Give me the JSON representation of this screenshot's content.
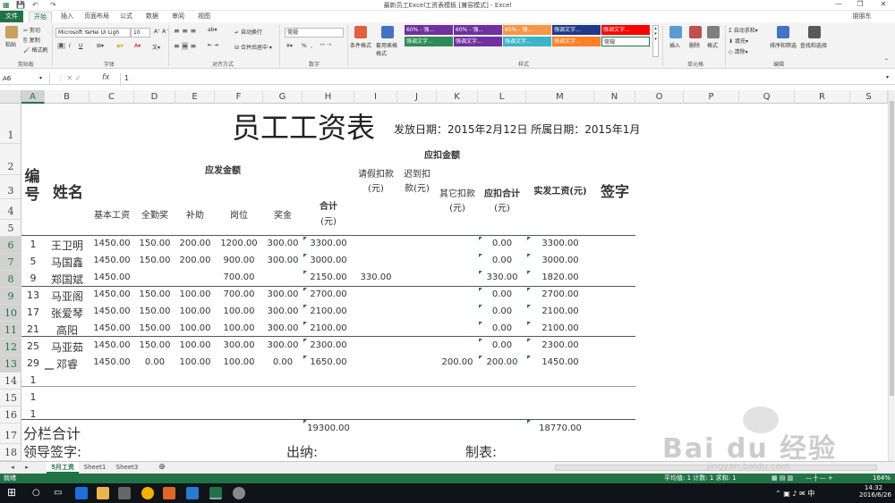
{
  "window": {
    "title": "最新员工Excel工资表模板 [兼容模式] - Excel",
    "user": "朋朋东"
  },
  "tabs": [
    "文件",
    "开始",
    "插入",
    "页面布局",
    "公式",
    "数据",
    "审阅",
    "视图"
  ],
  "ribbon": {
    "clipboard": {
      "paste": "粘贴",
      "cut": "剪切",
      "copy": "复制",
      "format_painter": "格式刷",
      "label": "剪贴板"
    },
    "font": {
      "name": "Microsoft YaHei UI Ligh",
      "size": "10",
      "label": "字体",
      "bold": "B",
      "italic": "I",
      "underline": "U"
    },
    "alignment": {
      "wrap": "自动换行",
      "merge": "合并后居中",
      "label": "对齐方式"
    },
    "number": {
      "format": "常规",
      "label": "数字",
      "percent": "%",
      "comma": ","
    },
    "styles": {
      "conditional": "条件格式",
      "table": "套用表格格式",
      "label": "样式",
      "cells": [
        {
          "text": "60% - 强...",
          "color": "#7030a0"
        },
        {
          "text": "60% - 强...",
          "color": "#7030a0"
        },
        {
          "text": "60% - 强...",
          "color": "#f79646"
        },
        {
          "text": "强调文字...",
          "color": "#1f3a8a"
        },
        {
          "text": "强调文字...",
          "color": "#ff0000"
        },
        {
          "text": "强调文字...",
          "color": "#2e8b57"
        },
        {
          "text": "强调文字...",
          "color": "#7030a0"
        },
        {
          "text": "强调文字...",
          "color": "#3cb4c8"
        },
        {
          "text": "强调文字...",
          "color": "#ff7f27"
        },
        {
          "text": "常规",
          "color": "#ffffff"
        }
      ]
    },
    "cells_grp": {
      "insert": "插入",
      "delete": "删除",
      "format": "格式",
      "label": "单元格"
    },
    "editing": {
      "autosum": "自动求和",
      "fill": "填充",
      "clear": "清除",
      "sort": "排序和筛选",
      "find": "查找和选择",
      "label": "编辑"
    }
  },
  "formula_bar": {
    "name_box": "A6",
    "fx": "fx",
    "value": "1"
  },
  "columns": [
    "A",
    "B",
    "C",
    "D",
    "E",
    "F",
    "G",
    "H",
    "I",
    "J",
    "K",
    "L",
    "M",
    "N",
    "O",
    "P",
    "Q",
    "R",
    "S"
  ],
  "row_numbers": [
    "1",
    "2",
    "3",
    "4",
    "5",
    "6",
    "7",
    "8",
    "9",
    "10",
    "11",
    "12",
    "13",
    "14",
    "15",
    "16",
    "17",
    "18"
  ],
  "sheet": {
    "title": "员工工资表",
    "dates": "发放日期：2015年2月12日 所属日期：2015年1月",
    "h_id": "编\n号",
    "h_name": "姓名",
    "h_payable": "应发金额",
    "h_deduct": "应扣金额",
    "h_basic": "基本工资",
    "h_attend": "全勤奖",
    "h_subsidy": "补助",
    "h_post": "岗位",
    "h_bonus": "奖金",
    "h_total": "合计",
    "h_total_unit": "(元)",
    "h_leave": "请假扣款",
    "h_leave_unit": "(元)",
    "h_late": "迟到扣",
    "h_late_unit": "款(元)",
    "h_other": "其它扣款",
    "h_other_unit": "(元)",
    "h_deduct_total": "应扣合计",
    "h_deduct_total_unit": "(元)",
    "h_net": "实发工资(元)",
    "h_sign": "签字",
    "rows": [
      {
        "id": "1",
        "name": "王卫明",
        "basic": "1450.00",
        "attend": "150.00",
        "subsidy": "200.00",
        "post": "1200.00",
        "bonus": "300.00",
        "total": "3300.00",
        "leave": "",
        "late": "",
        "other": "",
        "dtotal": "0.00",
        "net": "3300.00"
      },
      {
        "id": "5",
        "name": "马国鑫",
        "basic": "1450.00",
        "attend": "150.00",
        "subsidy": "200.00",
        "post": "900.00",
        "bonus": "300.00",
        "total": "3000.00",
        "leave": "",
        "late": "",
        "other": "",
        "dtotal": "0.00",
        "net": "3000.00"
      },
      {
        "id": "9",
        "name": "郑国斌",
        "basic": "1450.00",
        "attend": "",
        "subsidy": "",
        "post": "700.00",
        "bonus": "",
        "total": "2150.00",
        "leave": "330.00",
        "late": "",
        "other": "",
        "dtotal": "330.00",
        "net": "1820.00"
      },
      {
        "id": "13",
        "name": "马亚阁",
        "basic": "1450.00",
        "attend": "150.00",
        "subsidy": "100.00",
        "post": "700.00",
        "bonus": "300.00",
        "total": "2700.00",
        "leave": "",
        "late": "",
        "other": "",
        "dtotal": "0.00",
        "net": "2700.00"
      },
      {
        "id": "17",
        "name": "张爱琴",
        "basic": "1450.00",
        "attend": "150.00",
        "subsidy": "100.00",
        "post": "100.00",
        "bonus": "300.00",
        "total": "2100.00",
        "leave": "",
        "late": "",
        "other": "",
        "dtotal": "0.00",
        "net": "2100.00"
      },
      {
        "id": "21",
        "name": "高阳",
        "basic": "1450.00",
        "attend": "150.00",
        "subsidy": "100.00",
        "post": "100.00",
        "bonus": "300.00",
        "total": "2100.00",
        "leave": "",
        "late": "",
        "other": "",
        "dtotal": "0.00",
        "net": "2100.00"
      },
      {
        "id": "25",
        "name": "马亚茹",
        "basic": "1450.00",
        "attend": "150.00",
        "subsidy": "100.00",
        "post": "300.00",
        "bonus": "300.00",
        "total": "2300.00",
        "leave": "",
        "late": "",
        "other": "",
        "dtotal": "0.00",
        "net": "2300.00"
      },
      {
        "id": "29",
        "name": "邓睿",
        "basic": "1450.00",
        "attend": "0.00",
        "subsidy": "100.00",
        "post": "100.00",
        "bonus": "0.00",
        "total": "1650.00",
        "leave": "",
        "late": "",
        "other": "200.00",
        "dtotal": "200.00",
        "net": "1450.00"
      }
    ],
    "extra_ids": [
      "1",
      "1",
      "1"
    ],
    "subtotal_label": "分栏合计",
    "subtotal_total": "19300.00",
    "subtotal_net": "18770.00",
    "leader_sign": "领导签字:",
    "cashier": "出纳:",
    "maker": "制表:"
  },
  "sheet_tabs": [
    "5月工资",
    "Sheet1",
    "Sheet3"
  ],
  "status": {
    "ready": "就绪",
    "summary": "平均值: 1  计数: 1  求和: 1",
    "zoom": "164%"
  },
  "taskbar": {
    "time": "14:32",
    "date": "2016/6/26"
  },
  "watermark": {
    "text": "Bai du 经验",
    "url": "jingyan.baidu.com"
  }
}
